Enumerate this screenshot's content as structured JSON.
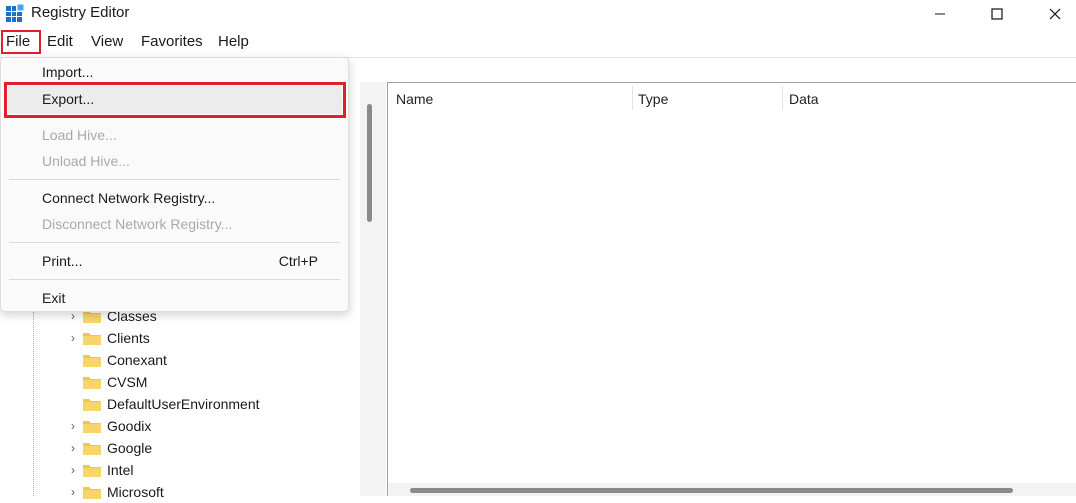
{
  "window": {
    "title": "Registry Editor"
  },
  "menubar": [
    "File",
    "Edit",
    "View",
    "Favorites",
    "Help"
  ],
  "file_menu": {
    "import": "Import...",
    "export": "Export...",
    "load_hive": "Load Hive...",
    "unload_hive": "Unload Hive...",
    "connect_network": "Connect Network Registry...",
    "disconnect_network": "Disconnect Network Registry...",
    "print": "Print...",
    "print_shortcut": "Ctrl+P",
    "exit": "Exit"
  },
  "columns": [
    "Name",
    "Type",
    "Data"
  ],
  "tree": [
    {
      "label": "Classes",
      "expandable": true
    },
    {
      "label": "Clients",
      "expandable": true
    },
    {
      "label": "Conexant",
      "expandable": false
    },
    {
      "label": "CVSM",
      "expandable": false
    },
    {
      "label": "DefaultUserEnvironment",
      "expandable": false
    },
    {
      "label": "Goodix",
      "expandable": true
    },
    {
      "label": "Google",
      "expandable": true
    },
    {
      "label": "Intel",
      "expandable": true
    },
    {
      "label": "Microsoft",
      "expandable": true
    }
  ],
  "colors": {
    "highlight_red": "#e01e2e",
    "folder_yellow": "#f3c64b"
  },
  "icons": {
    "app": "registry-editor-icon",
    "minimize": "minimize-icon",
    "maximize": "maximize-icon",
    "close": "close-icon",
    "folder": "folder-icon",
    "chevron": "chevron-right-icon"
  }
}
